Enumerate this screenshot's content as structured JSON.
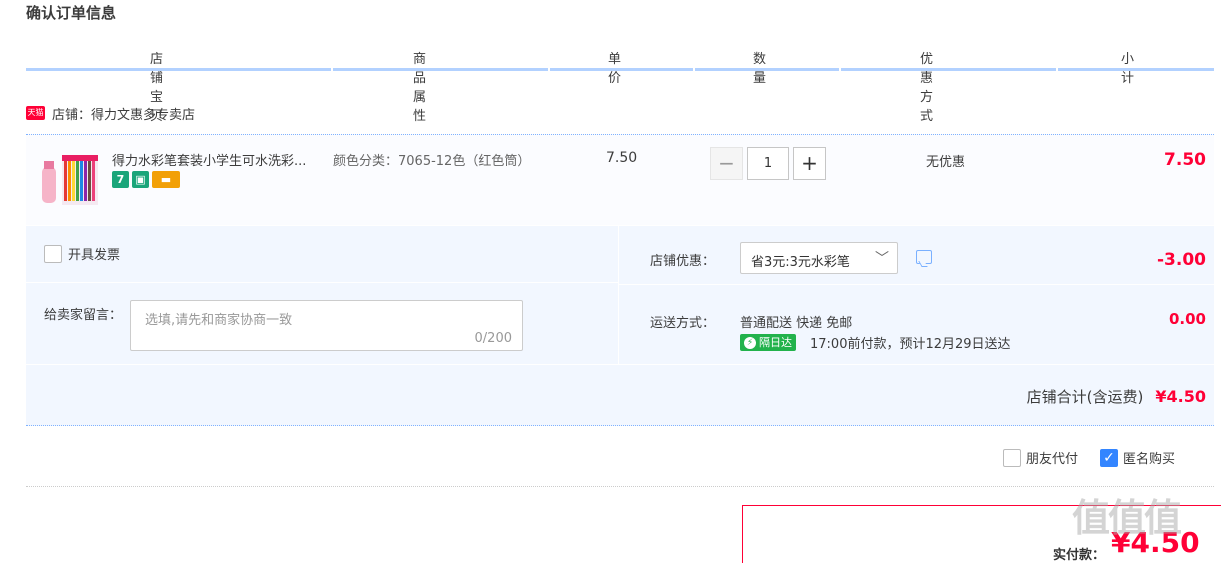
{
  "page_title": "确认订单信息",
  "columns": [
    "店铺宝贝",
    "商品属性",
    "单价",
    "数量",
    "优惠方式",
    "小计"
  ],
  "shop": {
    "badge": "天猫",
    "label": "店铺：得力文惠多专卖店"
  },
  "item": {
    "title": "得力水彩笔套装小学生可水洗彩...",
    "badges": [
      "7",
      "",
      ""
    ],
    "attribute": "颜色分类：7065-12色（红色筒）",
    "price": "7.50",
    "qty_minus": "−",
    "qty_value": "1",
    "qty_plus": "+",
    "discount": "无优惠",
    "subtotal": "7.50"
  },
  "invoice": {
    "label": "开具发票"
  },
  "message": {
    "label": "给卖家留言：",
    "placeholder": "选填,请先和商家协商一致",
    "count": "0/200"
  },
  "shop_discount": {
    "label": "店铺优惠：",
    "selected": "省3元:3元水彩笔",
    "amount": "-3.00"
  },
  "shipping": {
    "label": "运送方式：",
    "method": "普通配送 快递 免邮",
    "badge": "隔日达",
    "time": "17:00前付款，预计12月29日送达",
    "amount": "0.00"
  },
  "shop_total": {
    "label": "店铺合计(含运费)",
    "amount": "¥4.50"
  },
  "options": {
    "friend_pay": "朋友代付",
    "anonymous": "匿名购买"
  },
  "payment": {
    "label": "实付款：",
    "amount": "¥4.50"
  },
  "watermark": "值值值"
}
